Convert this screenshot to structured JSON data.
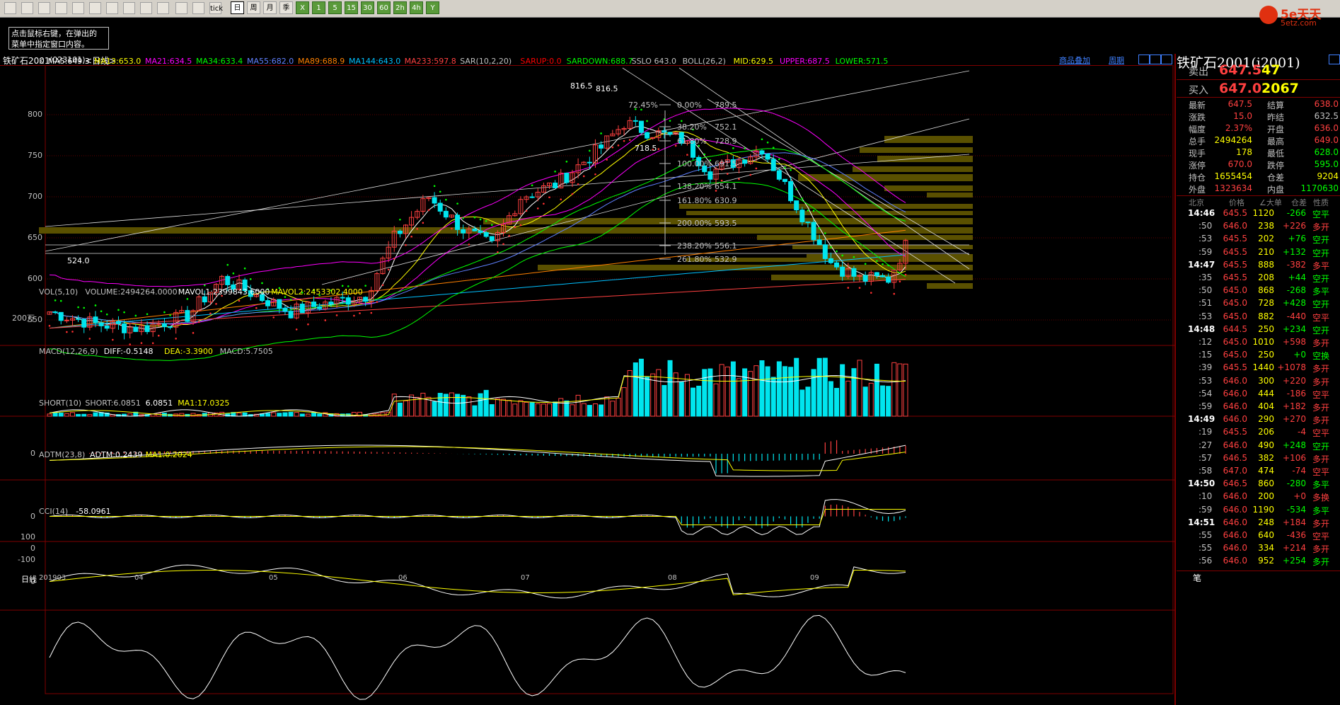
{
  "toolbar": {
    "icons": [
      "home-icon",
      "folder-icon",
      "news-icon",
      "refresh-icon",
      "zoom-in-icon",
      "zoom-out-icon",
      "window-icon",
      "pen-icon",
      "filter-icon",
      "grid-icon",
      "list-icon",
      "chart-icon",
      "tick-icon"
    ],
    "tick_label": "tick",
    "periods": [
      "日",
      "周",
      "月",
      "季",
      "X",
      "1",
      "5",
      "15",
      "30",
      "60",
      "2h",
      "4h",
      "Y"
    ],
    "selected_period": "日"
  },
  "hint": {
    "line1": "点击鼠标右键，在弹出的",
    "line2": "菜单中指定窗口内容。"
  },
  "logo": {
    "brand": "5e天天",
    "url": "5etz.com"
  },
  "chart": {
    "title": "铁矿石2001",
    "code": "(023101)",
    "period": "<日线>",
    "links": [
      "商品叠加",
      "周期"
    ],
    "ma_line": [
      {
        "t": "K",
        "c": "#c0c0c0"
      },
      {
        "t": "MA5:649.3",
        "c": "#ffffff"
      },
      {
        "t": "MA13:653.0",
        "c": "#ffff00"
      },
      {
        "t": "MA21:634.5",
        "c": "#ff00ff"
      },
      {
        "t": "MA34:633.4",
        "c": "#00ff00"
      },
      {
        "t": "MA55:682.0",
        "c": "#6080ff"
      },
      {
        "t": "MA89:688.9",
        "c": "#ff8000"
      },
      {
        "t": "MA144:643.0",
        "c": "#00c0ff"
      },
      {
        "t": "MA233:597.8",
        "c": "#ff4040"
      },
      {
        "t": "SAR(10,2,20)",
        "c": "#c0c0c0"
      },
      {
        "t": "SARUP:0.0",
        "c": "#ff0000"
      },
      {
        "t": "SARDOWN:688.7",
        "c": "#00ff00"
      },
      {
        "t": "SSLO 643.0",
        "c": "#c0c0c0"
      },
      {
        "t": "BOLL(26,2)",
        "c": "#c0c0c0"
      },
      {
        "t": "MID:629.5",
        "c": "#ffff00"
      },
      {
        "t": "UPPER:687.5",
        "c": "#ff00ff"
      },
      {
        "t": "LOWER:571.5",
        "c": "#00ff00"
      }
    ],
    "price_ticks": [
      "800",
      "750",
      "700",
      "650",
      "600",
      "550"
    ],
    "annotations": {
      "high": "816.5",
      "high2": "816.5",
      "low": "524.0",
      "mid_low": "718.5",
      "pct": "72.45%"
    },
    "fib": [
      {
        "p": "0.00%",
        "v": "789.5"
      },
      {
        "p": "38.20%",
        "v": "752.1"
      },
      {
        "p": "61.80%",
        "v": "728.9"
      },
      {
        "p": "100.00%",
        "v": "691.5"
      },
      {
        "p": "138.20%",
        "v": "654.1"
      },
      {
        "p": "161.80%",
        "v": "630.9"
      },
      {
        "p": "200.00%",
        "v": "593.5"
      },
      {
        "p": "238.20%",
        "v": "556.1"
      },
      {
        "p": "261.80%",
        "v": "532.9"
      }
    ],
    "x_axis": {
      "label": "日线",
      "dates": [
        "201903",
        "04",
        "05",
        "06",
        "07",
        "08",
        "09"
      ]
    }
  },
  "panels": {
    "vol": {
      "header": [
        {
          "t": "VOL(5,10)",
          "c": "#c0c0c0"
        },
        {
          "t": "VOLUME:2494264.0000",
          "c": "#c0c0c0"
        },
        {
          "t": "MAVOL1:2399843.6000",
          "c": "#ffffff"
        },
        {
          "t": "MAVOL2:2453302.4000",
          "c": "#ffff00"
        }
      ],
      "tick": "200万"
    },
    "macd": {
      "header": [
        {
          "t": "MACD(12,26,9)",
          "c": "#c0c0c0"
        },
        {
          "t": "DIFF:-0.5148",
          "c": "#ffffff"
        },
        {
          "t": "DEA:-3.3900",
          "c": "#ffff00"
        },
        {
          "t": "MACD:5.7505",
          "c": "#c0c0c0"
        }
      ],
      "tick": "0"
    },
    "short": {
      "header": [
        {
          "t": "SHORT(10)",
          "c": "#c0c0c0"
        },
        {
          "t": "SHORT:6.0851",
          "c": "#c0c0c0"
        },
        {
          "t": "6.0851",
          "c": "#ffffff"
        },
        {
          "t": "MA1:17.0325",
          "c": "#ffff00"
        }
      ],
      "tick": "0"
    },
    "adtm": {
      "header": [
        {
          "t": "ADTM(23,8)",
          "c": "#c0c0c0"
        },
        {
          "t": "ADTM:0.2439",
          "c": "#ffffff"
        },
        {
          "t": "MA1:0.2024",
          "c": "#ffff00"
        }
      ],
      "tick": "0"
    },
    "cci": {
      "header": [
        {
          "t": "CCI(14)",
          "c": "#c0c0c0"
        },
        {
          "t": "-58.0961",
          "c": "#ffffff"
        }
      ],
      "ticks": [
        "100",
        "0",
        "-100"
      ]
    }
  },
  "quote": {
    "title": "铁矿石2001(i2001)",
    "sell": {
      "label": "卖出",
      "price": "647.5",
      "vol": "47"
    },
    "buy": {
      "label": "买入",
      "price": "647.0",
      "vol": "2067"
    },
    "rows": [
      {
        "k": "最新",
        "v": "647.5",
        "vc": "#ff4040",
        "k2": "结算",
        "v2": "638.0",
        "v2c": "#ff4040"
      },
      {
        "k": "涨跌",
        "v": "15.0",
        "vc": "#ff4040",
        "k2": "昨结",
        "v2": "632.5",
        "v2c": "#c0c0c0"
      },
      {
        "k": "幅度",
        "v": "2.37%",
        "vc": "#ff4040",
        "k2": "开盘",
        "v2": "636.0",
        "v2c": "#ff4040"
      },
      {
        "k": "总手",
        "v": "2494264",
        "vc": "#ffff00",
        "k2": "最高",
        "v2": "649.0",
        "v2c": "#ff4040"
      },
      {
        "k": "现手",
        "v": "178",
        "vc": "#ffff00",
        "k2": "最低",
        "v2": "628.0",
        "v2c": "#00ff00"
      },
      {
        "k": "涨停",
        "v": "670.0",
        "vc": "#ff4040",
        "k2": "跌停",
        "v2": "595.0",
        "v2c": "#00ff00"
      },
      {
        "k": "持仓",
        "v": "1655454",
        "vc": "#ffff00",
        "k2": "仓差",
        "v2": "9204",
        "v2c": "#ffff00"
      },
      {
        "k": "外盘",
        "v": "1323634",
        "vc": "#ff4040",
        "k2": "内盘",
        "v2": "1170630",
        "v2c": "#00ff00"
      }
    ],
    "tick_header": {
      "loc": "北京",
      "price": "价格",
      "vol": "∠大单",
      "diff": "仓差",
      "nature": "性质"
    },
    "ticks": [
      {
        "t": "14:46",
        "big": true,
        "p": "645.5",
        "pc": "#ff4040",
        "v": "1120",
        "d": "-266",
        "dc": "#00ff00",
        "n": "空平",
        "nc": "#00ff00"
      },
      {
        "t": ":50",
        "big": false,
        "p": "646.0",
        "pc": "#ff4040",
        "v": "238",
        "d": "+226",
        "dc": "#ff4040",
        "n": "多开",
        "nc": "#ff4040"
      },
      {
        "t": ":53",
        "big": false,
        "p": "645.5",
        "pc": "#ff4040",
        "v": "202",
        "d": "+76",
        "dc": "#00ff00",
        "n": "空开",
        "nc": "#00ff00"
      },
      {
        "t": ":59",
        "big": false,
        "p": "645.5",
        "pc": "#ff4040",
        "v": "210",
        "d": "+132",
        "dc": "#00ff00",
        "n": "空开",
        "nc": "#00ff00"
      },
      {
        "t": "14:47",
        "big": true,
        "p": "645.5",
        "pc": "#ff4040",
        "v": "888",
        "d": "-382",
        "dc": "#ff4040",
        "n": "多平",
        "nc": "#ff4040"
      },
      {
        "t": ":35",
        "big": false,
        "p": "645.5",
        "pc": "#ff4040",
        "v": "208",
        "d": "+44",
        "dc": "#00ff00",
        "n": "空开",
        "nc": "#00ff00"
      },
      {
        "t": ":50",
        "big": false,
        "p": "645.0",
        "pc": "#ff4040",
        "v": "868",
        "d": "-268",
        "dc": "#00ff00",
        "n": "多平",
        "nc": "#00ff00"
      },
      {
        "t": ":51",
        "big": false,
        "p": "645.0",
        "pc": "#ff4040",
        "v": "728",
        "d": "+428",
        "dc": "#00ff00",
        "n": "空开",
        "nc": "#00ff00"
      },
      {
        "t": ":53",
        "big": false,
        "p": "645.0",
        "pc": "#ff4040",
        "v": "882",
        "d": "-440",
        "dc": "#ff4040",
        "n": "空平",
        "nc": "#ff4040"
      },
      {
        "t": "14:48",
        "big": true,
        "p": "644.5",
        "pc": "#ff4040",
        "v": "250",
        "d": "+234",
        "dc": "#00ff00",
        "n": "空开",
        "nc": "#00ff00"
      },
      {
        "t": ":12",
        "big": false,
        "p": "645.0",
        "pc": "#ff4040",
        "v": "1010",
        "d": "+598",
        "dc": "#ff4040",
        "n": "多开",
        "nc": "#ff4040"
      },
      {
        "t": ":15",
        "big": false,
        "p": "645.0",
        "pc": "#ff4040",
        "v": "250",
        "d": "+0",
        "dc": "#00ff00",
        "n": "空换",
        "nc": "#00ff00"
      },
      {
        "t": ":39",
        "big": false,
        "p": "645.5",
        "pc": "#ff4040",
        "v": "1440",
        "d": "+1078",
        "dc": "#ff4040",
        "n": "多开",
        "nc": "#ff4040"
      },
      {
        "t": ":53",
        "big": false,
        "p": "646.0",
        "pc": "#ff4040",
        "v": "300",
        "d": "+220",
        "dc": "#ff4040",
        "n": "多开",
        "nc": "#ff4040"
      },
      {
        "t": ":54",
        "big": false,
        "p": "646.0",
        "pc": "#ff4040",
        "v": "444",
        "d": "-186",
        "dc": "#ff4040",
        "n": "空平",
        "nc": "#ff4040"
      },
      {
        "t": ":59",
        "big": false,
        "p": "646.0",
        "pc": "#ff4040",
        "v": "404",
        "d": "+182",
        "dc": "#ff4040",
        "n": "多开",
        "nc": "#ff4040"
      },
      {
        "t": "14:49",
        "big": true,
        "p": "646.0",
        "pc": "#ff4040",
        "v": "290",
        "d": "+270",
        "dc": "#ff4040",
        "n": "多开",
        "nc": "#ff4040"
      },
      {
        "t": ":19",
        "big": false,
        "p": "645.5",
        "pc": "#ff4040",
        "v": "206",
        "d": "-4",
        "dc": "#ff4040",
        "n": "空平",
        "nc": "#ff4040"
      },
      {
        "t": ":27",
        "big": false,
        "p": "646.0",
        "pc": "#ff4040",
        "v": "490",
        "d": "+248",
        "dc": "#00ff00",
        "n": "空开",
        "nc": "#00ff00"
      },
      {
        "t": ":57",
        "big": false,
        "p": "646.5",
        "pc": "#ff4040",
        "v": "382",
        "d": "+106",
        "dc": "#ff4040",
        "n": "多开",
        "nc": "#ff4040"
      },
      {
        "t": ":58",
        "big": false,
        "p": "647.0",
        "pc": "#ff4040",
        "v": "474",
        "d": "-74",
        "dc": "#ff4040",
        "n": "空平",
        "nc": "#ff4040"
      },
      {
        "t": "14:50",
        "big": true,
        "p": "646.5",
        "pc": "#ff4040",
        "v": "860",
        "d": "-280",
        "dc": "#00ff00",
        "n": "多平",
        "nc": "#00ff00"
      },
      {
        "t": ":10",
        "big": false,
        "p": "646.0",
        "pc": "#ff4040",
        "v": "200",
        "d": "+0",
        "dc": "#ff4040",
        "n": "多换",
        "nc": "#ff4040"
      },
      {
        "t": ":59",
        "big": false,
        "p": "646.0",
        "pc": "#ff4040",
        "v": "1190",
        "d": "-534",
        "dc": "#00ff00",
        "n": "多平",
        "nc": "#00ff00"
      },
      {
        "t": "14:51",
        "big": true,
        "p": "646.0",
        "pc": "#ff4040",
        "v": "248",
        "d": "+184",
        "dc": "#ff4040",
        "n": "多开",
        "nc": "#ff4040"
      },
      {
        "t": ":55",
        "big": false,
        "p": "646.0",
        "pc": "#ff4040",
        "v": "640",
        "d": "-436",
        "dc": "#ff4040",
        "n": "空平",
        "nc": "#ff4040"
      },
      {
        "t": ":55",
        "big": false,
        "p": "646.0",
        "pc": "#ff4040",
        "v": "334",
        "d": "+214",
        "dc": "#ff4040",
        "n": "多开",
        "nc": "#ff4040"
      },
      {
        "t": ":56",
        "big": false,
        "p": "646.0",
        "pc": "#ff4040",
        "v": "952",
        "d": "+254",
        "dc": "#00ff00",
        "n": "多开",
        "nc": "#00ff00"
      }
    ],
    "footer_tab": "笔"
  }
}
